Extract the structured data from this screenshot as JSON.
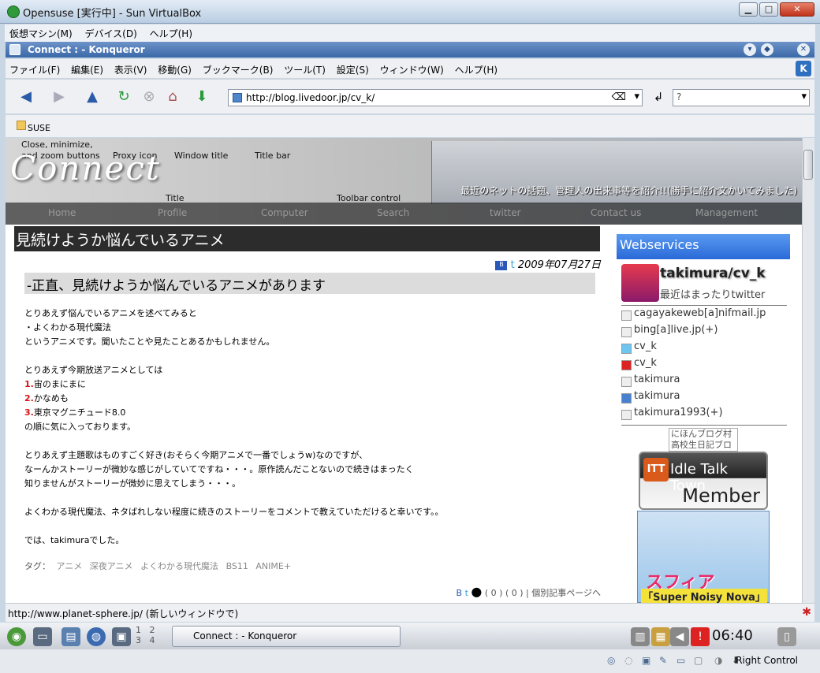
{
  "vbox": {
    "title": "Opensuse [実行中] - Sun VirtualBox",
    "menu": [
      "仮想マシン(M)",
      "デバイス(D)",
      "ヘルプ(H)"
    ],
    "win_min": "▁",
    "win_max": "□",
    "win_close": "✕",
    "host_key": "Right Control"
  },
  "konqueror": {
    "title": "Connect : - Konqueror",
    "menu": [
      "ファイル(F)",
      "編集(E)",
      "表示(V)",
      "移動(G)",
      "ブックマーク(B)",
      "ツール(T)",
      "設定(S)",
      "ウィンドウ(W)",
      "ヘルプ(H)"
    ],
    "url": "http://blog.livedoor.jp/cv_k/",
    "bookmark": "SUSE",
    "status": "http://www.planet-sphere.jp/ (新しいウィンドウで)"
  },
  "banner": {
    "logo": "Connect",
    "description": "最近のネットの話題、管理人の出来事等を紹介!!(勝手に紹介文かいてみました)",
    "nav": [
      "Home",
      "Profile",
      "Computer",
      "Search",
      "twitter",
      "Contact us",
      "Management"
    ],
    "notes": [
      "Close, minimize,",
      "and zoom buttons",
      "Proxy icon",
      "Window title",
      "Title bar",
      "Title",
      "Toolbar control"
    ]
  },
  "post": {
    "title": "見続けようか悩んでいるアニメ",
    "date": "2009年07月27日",
    "subtitle": "-正直、見続けようか悩んでいるアニメがあります",
    "lines": [
      "とりあえず悩んでいるアニメを述べてみると",
      "・よくわかる現代魔法",
      "というアニメです。聞いたことや見たことあるかもしれません。",
      "",
      "とりあえず今期放送アニメとしては"
    ],
    "ranked": [
      {
        "num": "1.",
        "title": "宙のまにまに"
      },
      {
        "num": "2.",
        "title": "かなめも"
      },
      {
        "num": "3.",
        "title": "東京マグニチュード8.0"
      }
    ],
    "lines2": [
      "の順に気に入っております。",
      "",
      "とりあえず主題歌はものすごく好き(おそらく今期アニメで一番でしょうw)なのですが、",
      "なーんかストーリーが微妙な感じがしていてですね・・・。原作読んだことないので続きはまったく",
      "知りませんがストーリーが微妙に思えてしまう・・・。",
      "",
      "よくわかる現代魔法、ネタばれしない程度に続きのストーリーをコメントで教えていただけると幸いです。。",
      "",
      "では、takimuraでした。"
    ],
    "tags_label": "タグ：",
    "tags": [
      "アニメ",
      "深夜アニメ",
      "よくわかる現代魔法",
      "BS11",
      "ANIME+"
    ],
    "footer": "( 0 ) ( 0 ) | 個別記事ページへ"
  },
  "sidebar": {
    "heading": "Webservices",
    "twitter_name": "takimura/cv_k",
    "twitter_status": "最近はまったりtwitter",
    "links": [
      "cagayakeweb[a]nifmail.jp",
      "bing[a]live.jp(+)",
      "cv_k",
      "cv_k",
      "takimura",
      "takimura",
      "takimura1993(+)"
    ],
    "nihon": "にほんブログ村 高校生日記ブロ",
    "itt_a": "Idle Talk Town",
    "itt_b": "Member",
    "itt_icon": "ITT",
    "sphere_a": "スフィア",
    "sphere_b": "「Super Noisy Nova」"
  },
  "panel": {
    "task": "Connect : - Konqueror",
    "pager": [
      "1",
      "2",
      "3",
      "4"
    ],
    "clock": "06:40"
  }
}
